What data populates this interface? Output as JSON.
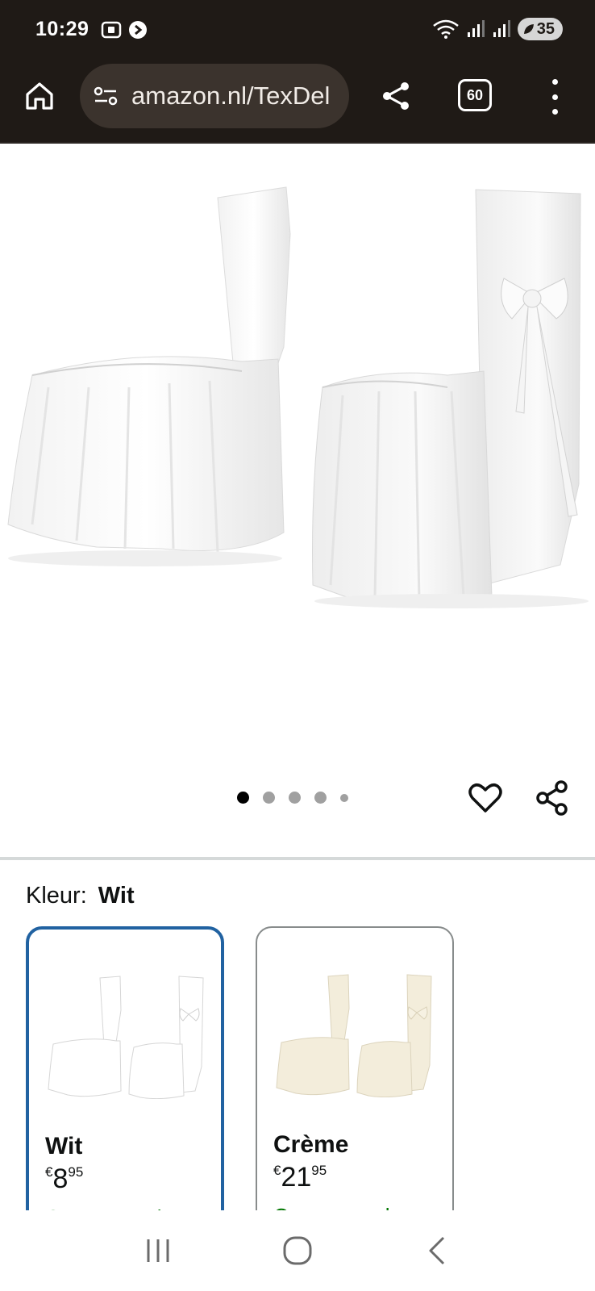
{
  "status_bar": {
    "time": "10:29",
    "battery": "35",
    "icons": [
      "screenshot-icon",
      "notification-icon",
      "wifi-icon",
      "signal-icon",
      "signal-icon",
      "battery-icon"
    ]
  },
  "browser": {
    "url": "amazon.nl/TexDel",
    "tab_count": "60"
  },
  "gallery": {
    "dots": 5,
    "active_dot": 1
  },
  "variant": {
    "label": "Kleur:",
    "selected_value": "Wit"
  },
  "swatches": [
    {
      "name": "Wit",
      "currency": "€",
      "price_whole": "8",
      "price_fraction": "95",
      "stock": "Op voorraad",
      "selected": true,
      "fabric_color": "#ffffff"
    },
    {
      "name": "Crème",
      "currency": "€",
      "price_whole": "21",
      "price_fraction": "95",
      "stock": "Op voorraad",
      "selected": false,
      "fabric_color": "#f1ebd9"
    }
  ]
}
